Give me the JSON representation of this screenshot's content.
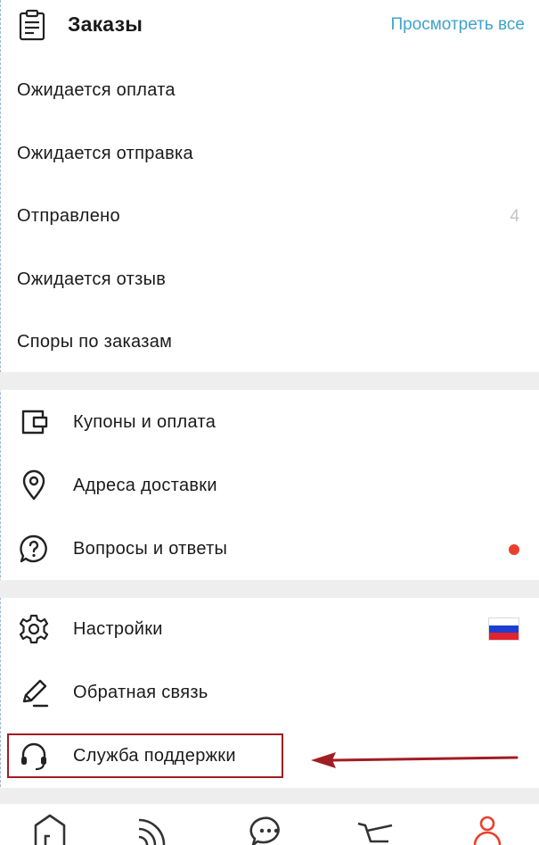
{
  "orders": {
    "title": "Заказы",
    "view_all": "Просмотреть все",
    "items": [
      {
        "label": "Ожидается оплата",
        "count": ""
      },
      {
        "label": "Ожидается отправка",
        "count": ""
      },
      {
        "label": "Отправлено",
        "count": "4"
      },
      {
        "label": "Ожидается отзыв",
        "count": ""
      },
      {
        "label": "Споры по заказам",
        "count": ""
      }
    ]
  },
  "menu1": [
    {
      "label": "Купоны и оплата",
      "icon": "wallet-icon"
    },
    {
      "label": "Адреса доставки",
      "icon": "location-pin-icon"
    },
    {
      "label": "Вопросы и ответы",
      "icon": "question-bubble-icon",
      "badge": "red-dot"
    }
  ],
  "menu2": [
    {
      "label": "Настройки",
      "icon": "gear-icon",
      "extra": "russia-flag"
    },
    {
      "label": "Обратная связь",
      "icon": "pencil-icon"
    },
    {
      "label": "Служба поддержки",
      "icon": "headset-icon",
      "highlighted": true
    }
  ],
  "tabbar": [
    "home-icon",
    "feed-icon",
    "messages-icon",
    "cart-icon",
    "account-icon"
  ],
  "colors": {
    "link": "#3fa3c9",
    "badge": "#e9402e",
    "annotation": "#a11d24",
    "active_tab": "#e9402e",
    "divider": "#eeeeee"
  }
}
